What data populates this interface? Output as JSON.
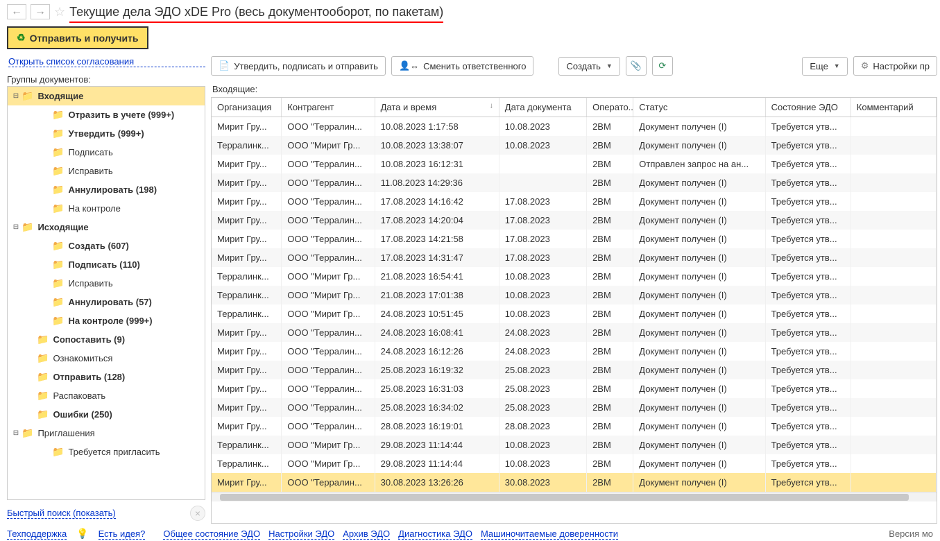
{
  "header": {
    "title": "Текущие дела ЭДО xDE Pro (весь документооборот, по пакетам)"
  },
  "toolbar": {
    "send_receive": "Отправить и получить",
    "approve_sign_send": "Утвердить, подписать и отправить",
    "change_responsible": "Сменить ответственного",
    "create": "Создать",
    "more": "Еще",
    "settings": "Настройки пр"
  },
  "left": {
    "agreement_link": "Открыть список согласования",
    "groups_label": "Группы документов:",
    "tree": [
      {
        "label": "Входящие",
        "bold": true,
        "selected": true,
        "indent": 0,
        "exp": "⊟"
      },
      {
        "label": "Отразить в учете (999+)",
        "bold": true,
        "indent": 2
      },
      {
        "label": "Утвердить (999+)",
        "bold": true,
        "indent": 2
      },
      {
        "label": "Подписать",
        "indent": 2
      },
      {
        "label": "Исправить",
        "indent": 2
      },
      {
        "label": "Аннулировать (198)",
        "bold": true,
        "indent": 2
      },
      {
        "label": "На контроле",
        "indent": 2
      },
      {
        "label": "Исходящие",
        "bold": true,
        "indent": 0,
        "exp": "⊟"
      },
      {
        "label": "Создать (607)",
        "bold": true,
        "indent": 2
      },
      {
        "label": "Подписать (110)",
        "bold": true,
        "indent": 2
      },
      {
        "label": "Исправить",
        "indent": 2
      },
      {
        "label": "Аннулировать (57)",
        "bold": true,
        "indent": 2
      },
      {
        "label": "На контроле (999+)",
        "bold": true,
        "indent": 2
      },
      {
        "label": "Сопоставить (9)",
        "bold": true,
        "indent": 1
      },
      {
        "label": "Ознакомиться",
        "indent": 1
      },
      {
        "label": "Отправить (128)",
        "bold": true,
        "indent": 1
      },
      {
        "label": "Распаковать",
        "indent": 1
      },
      {
        "label": "Ошибки (250)",
        "bold": true,
        "indent": 1
      },
      {
        "label": "Приглашения",
        "indent": 0,
        "exp": "⊟"
      },
      {
        "label": "Требуется пригласить",
        "indent": 2
      }
    ],
    "quick_search": "Быстрый поиск (показать)"
  },
  "right": {
    "section_label": "Входящие:",
    "columns": [
      "Организация",
      "Контрагент",
      "Дата и время",
      "Дата документа",
      "Операто...",
      "Статус",
      "Состояние ЭДО",
      "Комментарий"
    ],
    "rows": [
      {
        "org": "Мирит Гру...",
        "contr": "ООО \"Терралин...",
        "dt": "10.08.2023 1:17:58",
        "dd": "10.08.2023",
        "op": "2BM",
        "status": "Документ получен (I)",
        "edo": "Требуется утв..."
      },
      {
        "org": "Терралинк...",
        "contr": "ООО \"Мирит Гр...",
        "dt": "10.08.2023 13:38:07",
        "dd": "10.08.2023",
        "op": "2BM",
        "status": "Документ получен (I)",
        "edo": "Требуется утв..."
      },
      {
        "org": "Мирит Гру...",
        "contr": "ООО \"Терралин...",
        "dt": "10.08.2023 16:12:31",
        "dd": "",
        "op": "2BM",
        "status": "Отправлен запрос на ан...",
        "edo": "Требуется утв..."
      },
      {
        "org": "Мирит Гру...",
        "contr": "ООО \"Терралин...",
        "dt": "11.08.2023 14:29:36",
        "dd": "",
        "op": "2BM",
        "status": "Документ получен (I)",
        "edo": "Требуется утв..."
      },
      {
        "org": "Мирит Гру...",
        "contr": "ООО \"Терралин...",
        "dt": "17.08.2023 14:16:42",
        "dd": "17.08.2023",
        "op": "2BM",
        "status": "Документ получен (I)",
        "edo": "Требуется утв..."
      },
      {
        "org": "Мирит Гру...",
        "contr": "ООО \"Терралин...",
        "dt": "17.08.2023 14:20:04",
        "dd": "17.08.2023",
        "op": "2BM",
        "status": "Документ получен (I)",
        "edo": "Требуется утв..."
      },
      {
        "org": "Мирит Гру...",
        "contr": "ООО \"Терралин...",
        "dt": "17.08.2023 14:21:58",
        "dd": "17.08.2023",
        "op": "2BM",
        "status": "Документ получен (I)",
        "edo": "Требуется утв..."
      },
      {
        "org": "Мирит Гру...",
        "contr": "ООО \"Терралин...",
        "dt": "17.08.2023 14:31:47",
        "dd": "17.08.2023",
        "op": "2BM",
        "status": "Документ получен (I)",
        "edo": "Требуется утв..."
      },
      {
        "org": "Терралинк...",
        "contr": "ООО \"Мирит Гр...",
        "dt": "21.08.2023 16:54:41",
        "dd": "10.08.2023",
        "op": "2BM",
        "status": "Документ получен (I)",
        "edo": "Требуется утв..."
      },
      {
        "org": "Терралинк...",
        "contr": "ООО \"Мирит Гр...",
        "dt": "21.08.2023 17:01:38",
        "dd": "10.08.2023",
        "op": "2BM",
        "status": "Документ получен (I)",
        "edo": "Требуется утв..."
      },
      {
        "org": "Терралинк...",
        "contr": "ООО \"Мирит Гр...",
        "dt": "24.08.2023 10:51:45",
        "dd": "10.08.2023",
        "op": "2BM",
        "status": "Документ получен (I)",
        "edo": "Требуется утв..."
      },
      {
        "org": "Мирит Гру...",
        "contr": "ООО \"Терралин...",
        "dt": "24.08.2023 16:08:41",
        "dd": "24.08.2023",
        "op": "2BM",
        "status": "Документ получен (I)",
        "edo": "Требуется утв..."
      },
      {
        "org": "Мирит Гру...",
        "contr": "ООО \"Терралин...",
        "dt": "24.08.2023 16:12:26",
        "dd": "24.08.2023",
        "op": "2BM",
        "status": "Документ получен (I)",
        "edo": "Требуется утв..."
      },
      {
        "org": "Мирит Гру...",
        "contr": "ООО \"Терралин...",
        "dt": "25.08.2023 16:19:32",
        "dd": "25.08.2023",
        "op": "2BM",
        "status": "Документ получен (I)",
        "edo": "Требуется утв..."
      },
      {
        "org": "Мирит Гру...",
        "contr": "ООО \"Терралин...",
        "dt": "25.08.2023 16:31:03",
        "dd": "25.08.2023",
        "op": "2BM",
        "status": "Документ получен (I)",
        "edo": "Требуется утв..."
      },
      {
        "org": "Мирит Гру...",
        "contr": "ООО \"Терралин...",
        "dt": "25.08.2023 16:34:02",
        "dd": "25.08.2023",
        "op": "2BM",
        "status": "Документ получен (I)",
        "edo": "Требуется утв..."
      },
      {
        "org": "Мирит Гру...",
        "contr": "ООО \"Терралин...",
        "dt": "28.08.2023 16:19:01",
        "dd": "28.08.2023",
        "op": "2BM",
        "status": "Документ получен (I)",
        "edo": "Требуется утв..."
      },
      {
        "org": "Терралинк...",
        "contr": "ООО \"Мирит Гр...",
        "dt": "29.08.2023 11:14:44",
        "dd": "10.08.2023",
        "op": "2BM",
        "status": "Документ получен (I)",
        "edo": "Требуется утв..."
      },
      {
        "org": "Терралинк...",
        "contr": "ООО \"Мирит Гр...",
        "dt": "29.08.2023 11:14:44",
        "dd": "10.08.2023",
        "op": "2BM",
        "status": "Документ получен (I)",
        "edo": "Требуется утв..."
      },
      {
        "org": "Мирит Гру...",
        "contr": "ООО \"Терралин...",
        "dt": "30.08.2023 13:26:26",
        "dd": "30.08.2023",
        "op": "2BM",
        "status": "Документ получен (I)",
        "edo": "Требуется утв...",
        "selected": true
      }
    ]
  },
  "footer": {
    "support": "Техподдержка",
    "idea": "Есть идея?",
    "links": [
      "Общее состояние ЭДО",
      "Настройки ЭДО",
      "Архив ЭДО",
      "Диагностика ЭДО",
      "Машиночитаемые доверенности"
    ],
    "version": "Версия мо"
  }
}
